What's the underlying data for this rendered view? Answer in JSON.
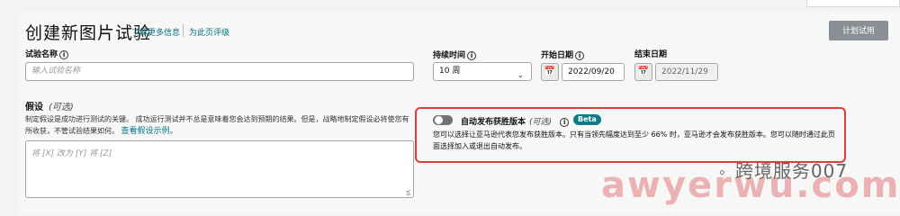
{
  "header": {
    "title": "创建新图片试验",
    "learn_more": "了解更多信息",
    "rate_page": "为此页评级",
    "plan_button": "计划试用"
  },
  "form": {
    "test_name_label": "试验名称",
    "test_name_placeholder": "输入试验名称",
    "duration_label": "持续时间",
    "duration_value": "10 周",
    "start_date_label": "开始日期",
    "start_date_value": "2022/09/20",
    "end_date_label": "结束日期",
    "end_date_value": "2022/11/29"
  },
  "hypothesis": {
    "title": "假设",
    "optional": "(可选)",
    "desc": "制定假设是成功进行测试的关键。 成功运行测试并不总是意味着您会达到预期的结果。但是，战略地制定假设必将使您有所收获，不管试验结果如何。",
    "example_link": "查看假设示例。",
    "placeholder": "将 [X] 改为 [Y] 将 [Z]"
  },
  "auto_publish": {
    "label": "自动发布获胜版本",
    "optional": "(可选)",
    "badge": "Beta",
    "desc": "您可以选择让亚马逊代表您发布获胜版本。只有当领先幅度达到至少 66% 时，亚马逊才会发布获胜版本。您可以随时通过此页面选择加入或退出自动发布。",
    "enabled": false
  },
  "watermark": {
    "text": "跨境服务007",
    "url": "awyerwu.com"
  }
}
